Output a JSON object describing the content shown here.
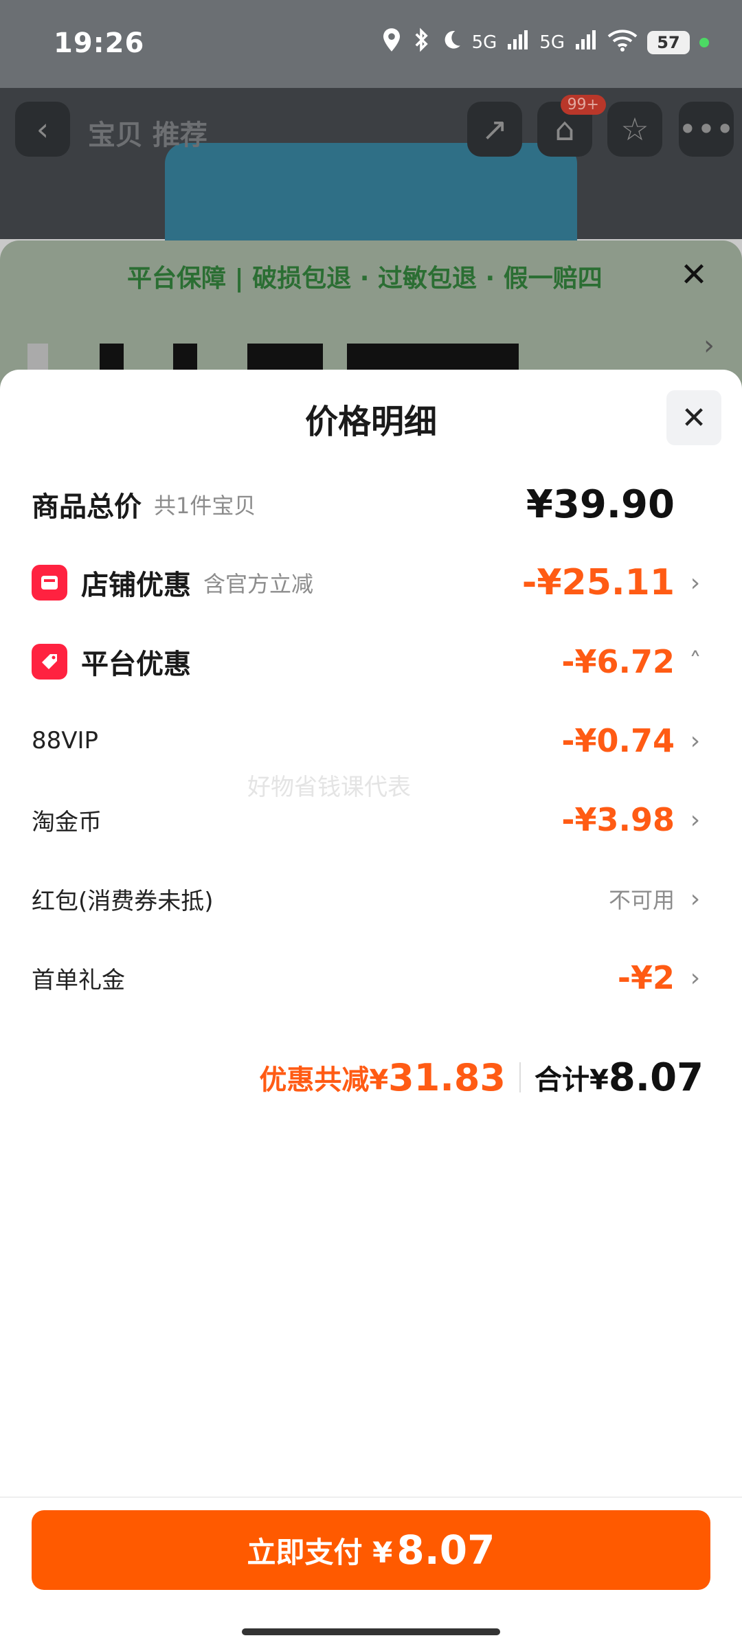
{
  "status": {
    "time": "19:26",
    "battery": "57",
    "network1": "5G",
    "network2": "5G"
  },
  "background": {
    "nav_title": "宝贝  推荐",
    "cart_badge": "99+",
    "guarantee": "平台保障 | 破损包退 · 过敏包退 · 假一赔四"
  },
  "sheet": {
    "title": "价格明细",
    "rows": [
      {
        "label": "商品总价",
        "sub": "共1件宝贝",
        "amount": "¥39.90"
      },
      {
        "label": "店铺优惠",
        "sub": "含官方立减",
        "amount": "-¥25.11"
      },
      {
        "label": "平台优惠",
        "amount": "-¥6.72"
      },
      {
        "label": "88VIP",
        "amount": "-¥0.74"
      },
      {
        "label": "淘金币",
        "amount": "-¥3.98"
      },
      {
        "label": "红包(消费券未抵)",
        "amount": "不可用"
      },
      {
        "label": "首单礼金",
        "amount": "-¥2"
      }
    ],
    "watermark": "好物省钱课代表",
    "summary": {
      "saved_label": "优惠共减¥",
      "saved_value": "31.83",
      "total_label": "合计¥",
      "total_value": "8.07"
    }
  },
  "pay_button": {
    "label": "立即支付 ¥",
    "value": "8.07"
  },
  "colors": {
    "accent": "#ff5a00",
    "discount": "#ff5b14",
    "badge": "#ff2240"
  }
}
